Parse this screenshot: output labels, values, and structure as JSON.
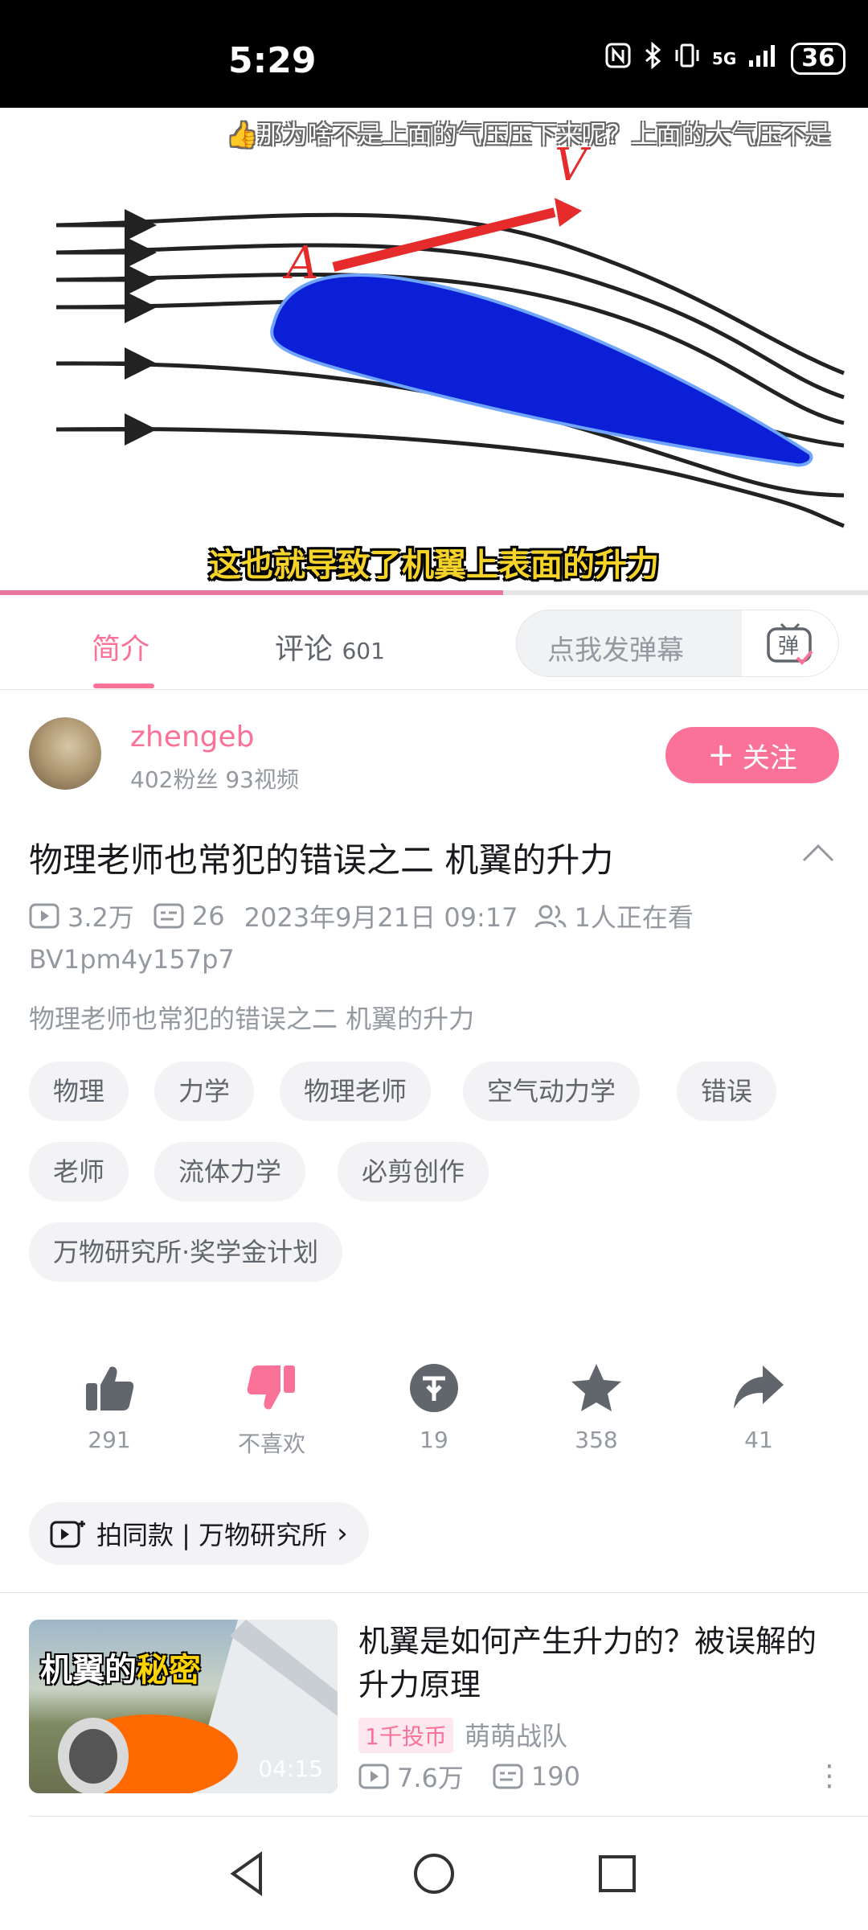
{
  "status_bar": {
    "time": "5:29",
    "network": "5G",
    "battery": "36"
  },
  "video": {
    "danmaku_text": "👍那为啥不是上面的气压压下来呢？上面的大气压不是",
    "subtitle": "这也就导致了机翼上表面的升力",
    "diagram_labels": {
      "point": "A",
      "velocity": "V"
    },
    "progress": 0.58
  },
  "tabs": {
    "intro": "简介",
    "comments": "评论",
    "comments_count": "601",
    "danmaku_placeholder": "点我发弹幕",
    "danmaku_button": "弹"
  },
  "uploader": {
    "name": "zhengeb",
    "stats": "402粉丝   93视频",
    "follow_label": "关注"
  },
  "video_info": {
    "title": "物理老师也常犯的错误之二 机翼的升力",
    "views": "3.2万",
    "danmaku_count": "26",
    "date": "2023年9月21日 09:17",
    "watching": "1人正在看",
    "bvid": "BV1pm4y157p7",
    "description": "物理老师也常犯的错误之二 机翼的升力"
  },
  "tags": [
    "物理",
    "力学",
    "物理老师",
    "空气动力学",
    "错误",
    "老师",
    "流体力学",
    "必剪创作",
    "万物研究所·奖学金计划"
  ],
  "actions": {
    "like": "291",
    "dislike": "不喜欢",
    "coin": "19",
    "favorite": "358",
    "share": "41"
  },
  "same_style": "拍同款 | 万物研究所",
  "related": {
    "thumb_title_a": "机翼的",
    "thumb_title_b": "秘密",
    "duration": "04:15",
    "title": "机翼是如何产生升力的？被误解的升力原理",
    "badge": "1千投币",
    "author": "萌萌战队",
    "views": "7.6万",
    "danmaku": "190"
  },
  "colors": {
    "accent": "#fb7299",
    "subtitle": "#f5d329",
    "airfoil": "#0a1fd6"
  }
}
